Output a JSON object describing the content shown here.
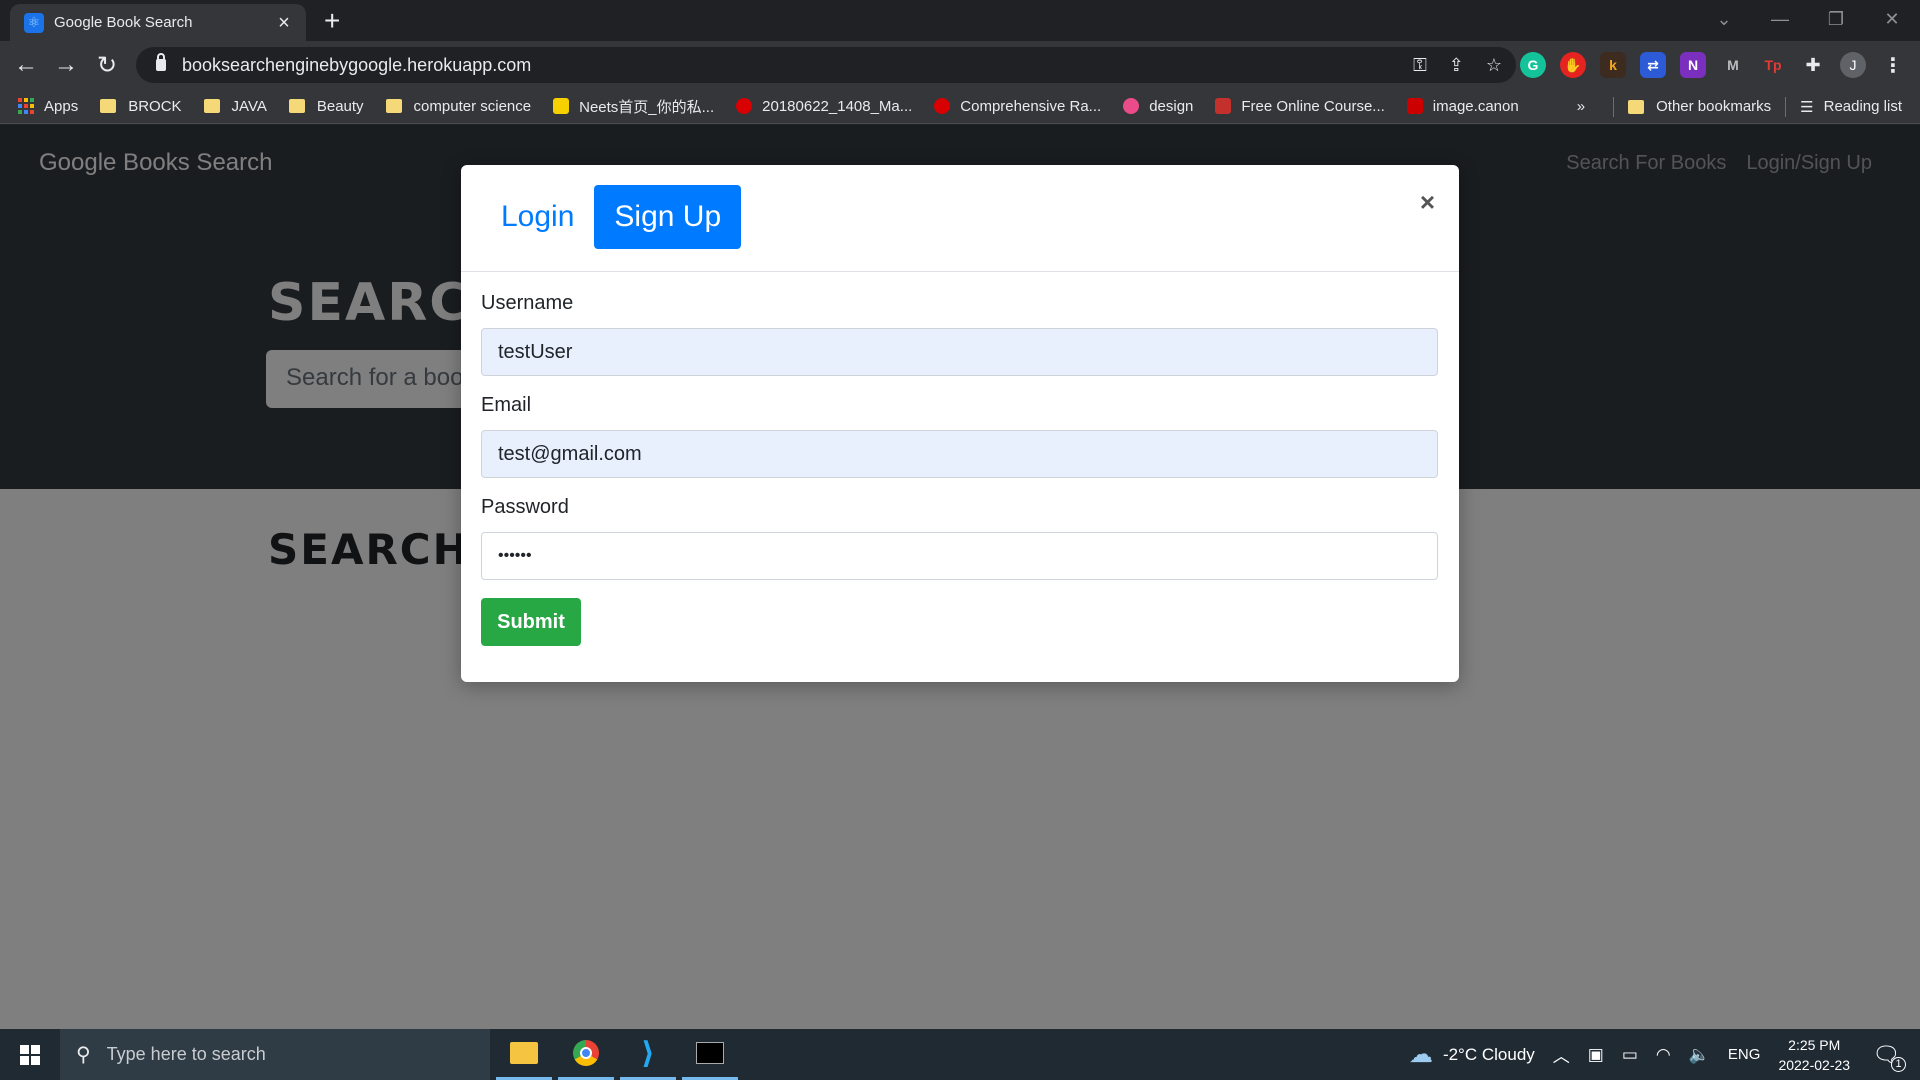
{
  "browser": {
    "tab_title": "Google Book Search",
    "tab_close": "×",
    "new_tab": "+",
    "url": "booksearchenginebygoogle.herokuapp.com",
    "bookmarks": [
      {
        "label": "Apps",
        "kind": "apps"
      },
      {
        "label": "BROCK",
        "kind": "folder"
      },
      {
        "label": "JAVA",
        "kind": "folder"
      },
      {
        "label": "Beauty",
        "kind": "folder"
      },
      {
        "label": "computer science",
        "kind": "folder"
      },
      {
        "label": "Neets首页_你的私...",
        "kind": "site",
        "color": "#f7d000"
      },
      {
        "label": "20180622_1408_Ma...",
        "kind": "site",
        "color": "#d80000"
      },
      {
        "label": "Comprehensive Ra...",
        "kind": "site",
        "color": "#d80000"
      },
      {
        "label": "design",
        "kind": "site",
        "color": "#ea4c89"
      },
      {
        "label": "Free Online Course...",
        "kind": "site",
        "color": "#c4302b"
      },
      {
        "label": "image.canon",
        "kind": "site",
        "color": "#cc0000"
      }
    ],
    "bookmarks_overflow": "»",
    "other_bookmarks": "Other bookmarks",
    "reading_list": "Reading list",
    "profile_initial": "J"
  },
  "site": {
    "brand": "Google Books Search",
    "nav_links": [
      "Search For Books",
      "Login/Sign Up"
    ],
    "hero_title": "SEARCH FOR BOOKS!",
    "search_placeholder": "Search for a book",
    "results_title": "SEARCH FOR A BOOK TO BEGIN"
  },
  "modal": {
    "tabs": [
      "Login",
      "Sign Up"
    ],
    "active_tab": "Sign Up",
    "close": "×",
    "fields": {
      "username_label": "Username",
      "username_value": "testUser",
      "email_label": "Email",
      "email_value": "test@gmail.com",
      "password_label": "Password",
      "password_value": "••••••"
    },
    "submit_label": "Submit"
  },
  "taskbar": {
    "search_placeholder": "Type here to search",
    "weather": "-2°C  Cloudy",
    "language": "ENG",
    "time": "2:25 PM",
    "date": "2022-02-23",
    "notification_count": "1"
  },
  "colors": {
    "primary": "#007bff",
    "success": "#28a745",
    "navbar": "#343a40",
    "autofill": "#e8f0fe"
  }
}
